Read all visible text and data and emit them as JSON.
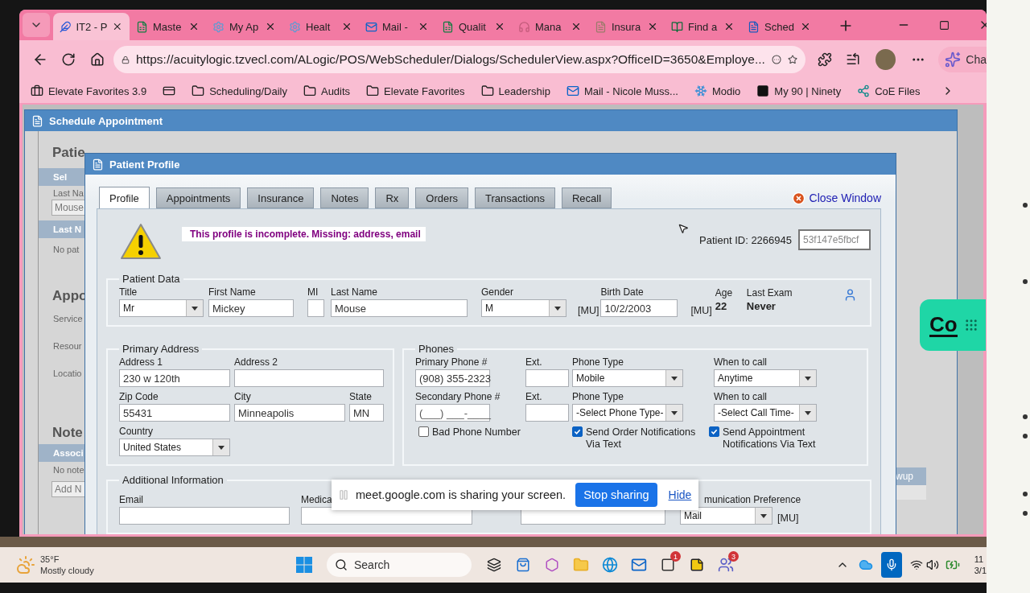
{
  "browser": {
    "tabs": [
      {
        "title": "IT2 - P",
        "selected": true
      },
      {
        "title": "Maste",
        "selected": false
      },
      {
        "title": "My Ap",
        "selected": false
      },
      {
        "title": "Healt",
        "selected": false
      },
      {
        "title": "Mail -",
        "selected": false
      },
      {
        "title": "Qualit",
        "selected": false
      },
      {
        "title": "Mana",
        "selected": false
      },
      {
        "title": "Insura",
        "selected": false
      },
      {
        "title": "Find a",
        "selected": false
      },
      {
        "title": "Sched",
        "selected": false
      }
    ],
    "url": "https://acuitylogic.tzvecl.com/ALogic/POS/WebScheduler/Dialogs/SchedulerView.aspx?OfficeID=3650&Employe...",
    "copilot_label": "Cha",
    "bookmarks": [
      {
        "label": "Elevate Favorites 3.9"
      },
      {
        "label": "Scheduling/Daily"
      },
      {
        "label": "Audits"
      },
      {
        "label": "Elevate Favorites"
      },
      {
        "label": "Leadership"
      },
      {
        "label": "Mail - Nicole Muss..."
      },
      {
        "label": "Modio"
      },
      {
        "label": "My 90 | Ninety"
      },
      {
        "label": "CoE Files"
      }
    ]
  },
  "schedule_dialog": {
    "title": "Schedule Appointment",
    "patient_legend": "Patie",
    "select_header": "Sel",
    "last_name_label": "Last Na",
    "last_name_value": "Mouse",
    "results_header": "Last N",
    "results_empty": "No pat",
    "appointment_legend": "Appo",
    "appointment_labels": [
      "Service",
      "Resour",
      "Locatio"
    ],
    "notes_legend": "Note",
    "notes_header": "Associ",
    "notes_empty": "No note",
    "notes_placeholder": "Add N",
    "right_header": "wup"
  },
  "patient_profile": {
    "title": "Patient Profile",
    "tabs": [
      {
        "label": "Profile",
        "selected": true
      },
      {
        "label": "Appointments",
        "selected": false
      },
      {
        "label": "Insurance",
        "selected": false
      },
      {
        "label": "Notes",
        "selected": false
      },
      {
        "label": "Rx",
        "selected": false
      },
      {
        "label": "Orders",
        "selected": false
      },
      {
        "label": "Transactions",
        "selected": false
      },
      {
        "label": "Recall",
        "selected": false
      }
    ],
    "close_label": "Close Window",
    "warning": "This profile is incomplete. Missing: address, email",
    "patient_id": "Patient ID: 2266945",
    "patient_key": "53f147e5fbcf",
    "patient_data": {
      "legend": "Patient Data",
      "title": {
        "label": "Title",
        "value": "Mr"
      },
      "first_name": {
        "label": "First Name",
        "value": "Mickey"
      },
      "mi": {
        "label": "MI"
      },
      "last_name": {
        "label": "Last Name",
        "value": "Mouse"
      },
      "gender": {
        "label": "Gender",
        "value": "M"
      },
      "gender_tag": "[MU]",
      "birth_date": {
        "label": "Birth Date",
        "value": "10/2/2003"
      },
      "birth_tag": "[MU]",
      "age": {
        "label": "Age",
        "value": "22"
      },
      "last_exam": {
        "label": "Last Exam",
        "value": "Never"
      }
    },
    "address": {
      "legend": "Primary Address",
      "address1": {
        "label": "Address 1",
        "value": "230 w 120th"
      },
      "address2": {
        "label": "Address 2"
      },
      "zip": {
        "label": "Zip Code",
        "value": "55431"
      },
      "city": {
        "label": "City",
        "value": "Minneapolis"
      },
      "state": {
        "label": "State",
        "value": "MN"
      },
      "country": {
        "label": "Country",
        "value": "United States"
      }
    },
    "phones": {
      "legend": "Phones",
      "rows": [
        {
          "phone": {
            "label": "Primary Phone #",
            "value": "(908) 355-2323"
          },
          "ext": {
            "label": "Ext."
          },
          "type": {
            "label": "Phone Type",
            "value": "Mobile"
          },
          "when": {
            "label": "When to call",
            "value": "Anytime"
          }
        },
        {
          "phone": {
            "label": "Secondary Phone #",
            "placeholder": "(___) ___-____"
          },
          "ext": {
            "label": "Ext."
          },
          "type": {
            "label": "Phone Type",
            "value": "-Select Phone Type-"
          },
          "when": {
            "label": "When to call",
            "value": "-Select Call Time-"
          }
        }
      ],
      "bad_phone": {
        "label": "Bad Phone Number",
        "checked": false
      },
      "order_text": {
        "label": "Send Order Notifications Via Text",
        "checked": true
      },
      "appointment_text": {
        "label": "Send Appointment Notifications Via Text",
        "checked": true
      }
    },
    "additional": {
      "legend": "Additional Information",
      "email": {
        "label": "Email"
      },
      "medical": {
        "label": "Medica"
      },
      "preference": {
        "label": "munication Preference",
        "value": "Mail"
      },
      "preference_tag": "[MU]"
    }
  },
  "share_bar": {
    "message": "meet.google.com is sharing your screen.",
    "stop": "Stop sharing",
    "hide": "Hide"
  },
  "widget": {
    "label": "Co"
  },
  "taskbar": {
    "temperature": "35°F",
    "weather": "Mostly cloudy",
    "search": "Search",
    "badges": [
      "1",
      "3"
    ],
    "time": "11",
    "date": "3/1"
  }
}
